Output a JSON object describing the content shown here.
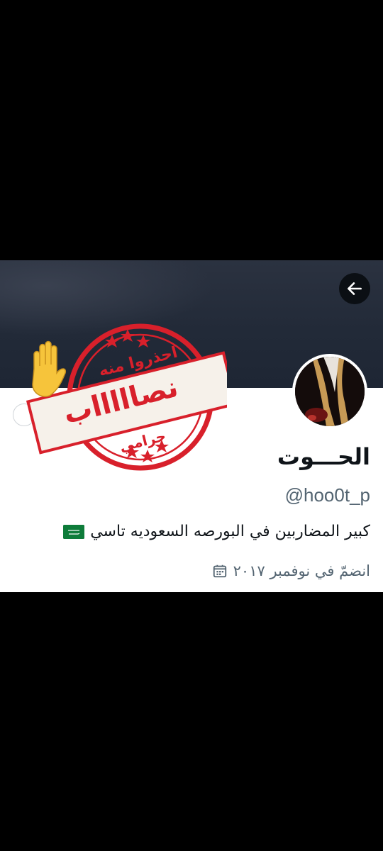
{
  "profile": {
    "display_name": "الحـــوت",
    "handle": "@hoo0t_p",
    "bio": "كبير المضاربين في  البورصه السعوديه تاسي",
    "bio_flag_icon": "saudi-flag-icon",
    "joined": "انضمّ في نوفمبر ٢٠١٧",
    "joined_icon": "calendar-icon"
  },
  "header": {
    "back_icon": "arrow-left-icon"
  },
  "stamp": {
    "top_text": "احذروا منه",
    "main_text": "نصاااااب",
    "bottom_text": "حرامي",
    "color": "#d8202b",
    "hand_icon": "raised-hand-icon"
  },
  "colors": {
    "banner": "#242c3a",
    "text_primary": "#0f1419",
    "text_secondary": "#536471",
    "stamp_red": "#d8202b"
  }
}
